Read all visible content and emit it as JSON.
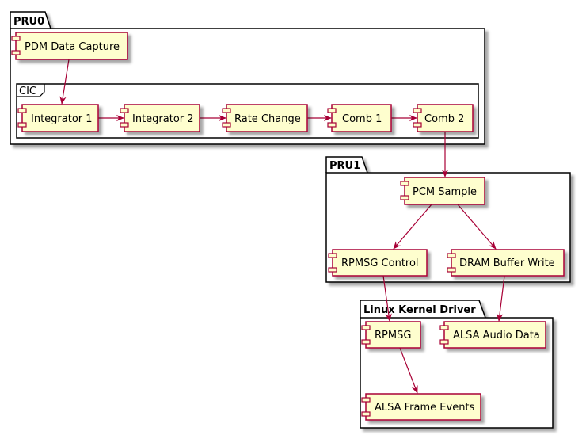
{
  "diagram": {
    "type": "component",
    "colors": {
      "component_fill": "#FEFECE",
      "component_border": "#A80036",
      "arrow": "#A80036",
      "package_border": "#000000",
      "package_fill": "#FFFFFF",
      "shadow": "#C0C0C0"
    },
    "packages": {
      "pru0": {
        "label": "PRU0"
      },
      "cic": {
        "label": "CIC"
      },
      "pru1": {
        "label": "PRU1"
      },
      "linux": {
        "label": "Linux Kernel Driver"
      }
    },
    "components": {
      "pdm": {
        "label": "PDM Data Capture",
        "package": "PRU0"
      },
      "int1": {
        "label": "Integrator 1",
        "package": "CIC"
      },
      "int2": {
        "label": "Integrator 2",
        "package": "CIC"
      },
      "rate": {
        "label": "Rate Change",
        "package": "CIC"
      },
      "comb1": {
        "label": "Comb 1",
        "package": "CIC"
      },
      "comb2": {
        "label": "Comb 2",
        "package": "CIC"
      },
      "pcm": {
        "label": "PCM Sample",
        "package": "PRU1"
      },
      "rpmsgctl": {
        "label": "RPMSG Control",
        "package": "PRU1"
      },
      "dram": {
        "label": "DRAM Buffer Write",
        "package": "PRU1"
      },
      "rpmsg": {
        "label": "RPMSG",
        "package": "Linux Kernel Driver"
      },
      "alsaaudio": {
        "label": "ALSA Audio Data",
        "package": "Linux Kernel Driver"
      },
      "alsaframe": {
        "label": "ALSA Frame Events",
        "package": "Linux Kernel Driver"
      }
    },
    "edges": [
      {
        "from": "PDM Data Capture",
        "to": "Integrator 1"
      },
      {
        "from": "Integrator 1",
        "to": "Integrator 2"
      },
      {
        "from": "Integrator 2",
        "to": "Rate Change"
      },
      {
        "from": "Rate Change",
        "to": "Comb 1"
      },
      {
        "from": "Comb 1",
        "to": "Comb 2"
      },
      {
        "from": "Comb 2",
        "to": "PCM Sample"
      },
      {
        "from": "PCM Sample",
        "to": "RPMSG Control"
      },
      {
        "from": "PCM Sample",
        "to": "DRAM Buffer Write"
      },
      {
        "from": "RPMSG Control",
        "to": "RPMSG"
      },
      {
        "from": "DRAM Buffer Write",
        "to": "ALSA Audio Data"
      },
      {
        "from": "RPMSG",
        "to": "ALSA Frame Events"
      }
    ]
  }
}
